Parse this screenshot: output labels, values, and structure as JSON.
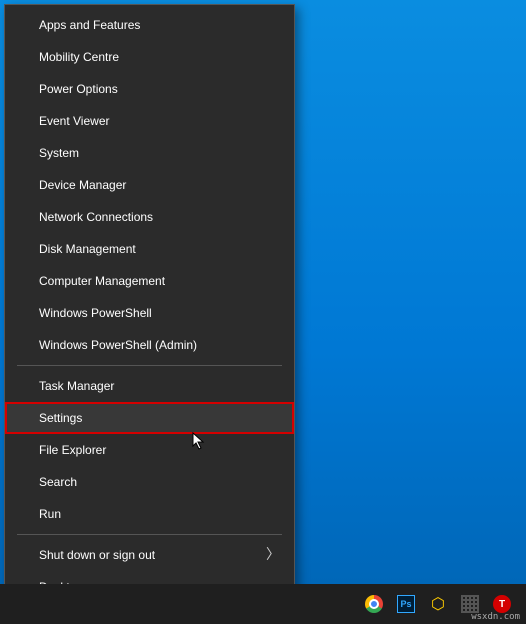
{
  "menu": {
    "group1": [
      "Apps and Features",
      "Mobility Centre",
      "Power Options",
      "Event Viewer",
      "System",
      "Device Manager",
      "Network Connections",
      "Disk Management",
      "Computer Management",
      "Windows PowerShell",
      "Windows PowerShell (Admin)"
    ],
    "group2": [
      "Task Manager",
      "Settings",
      "File Explorer",
      "Search",
      "Run"
    ],
    "group3": {
      "shutdown": "Shut down or sign out",
      "desktop": "Desktop"
    }
  },
  "highlighted": "Settings",
  "taskbar": {
    "icons": {
      "chrome": "chrome-icon",
      "photoshop": "Ps",
      "cube": "⬡",
      "grid": "grid-icon",
      "t": "T"
    }
  },
  "watermark": "wsxdn.com"
}
